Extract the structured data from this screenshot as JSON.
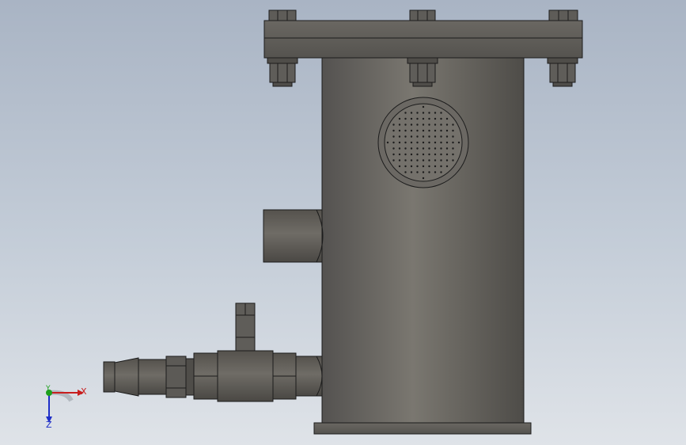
{
  "viewport": {
    "background_top": "#a9b4c4",
    "background_bottom": "#dfe3e8"
  },
  "model": {
    "body_color": "#6e6b65",
    "edge_color": "#1c1c1c",
    "dark_color": "#4a4844"
  },
  "triad": {
    "x_label": "X",
    "y_label": "Y",
    "z_label": "Z",
    "x_color": "#c81e1e",
    "y_color": "#1ea01e",
    "z_color": "#1e2ec8"
  }
}
